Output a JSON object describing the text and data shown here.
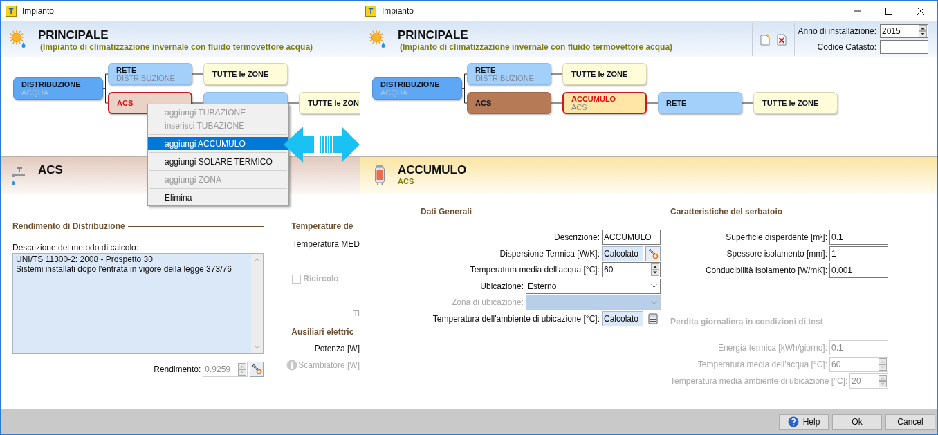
{
  "left_window": {
    "title": "Impianto",
    "icon_letter": "T",
    "header": {
      "title": "PRINCIPALE",
      "subtitle": "(Impianto di climatizzazione invernale con fluido termovettore acqua)"
    },
    "diagram": {
      "label": "DISTRIBUZIONE",
      "sublabel": "ACQUA",
      "kind": "distribuzione",
      "selected": false,
      "children": [
        {
          "label": "RETE",
          "sublabel": "DISTRIBUZIONE",
          "kind": "rete",
          "selected": false,
          "children": [
            {
              "label": "TUTTE le ZONE",
              "kind": "zone",
              "selected": false
            }
          ]
        },
        {
          "label": "ACS",
          "kind": "acs",
          "selected": true,
          "children": [
            {
              "kind": "rete",
              "selected": false,
              "children": [
                {
                  "label": "TUTTE le ZON",
                  "kind": "zone",
                  "selected": false
                }
              ]
            }
          ]
        }
      ]
    },
    "section": {
      "kind": "acs",
      "title": "ACS"
    },
    "distribution": {
      "heading": "Rendimento di Distribuzione",
      "description_label": "Descrizione del metodo di calcolo:",
      "description": "UNI/TS 11300-2: 2008 - Prospetto 30\nSistemi installati dopo l'entrata in vigore della legge 373/76",
      "efficiency_label": "Rendimento:",
      "efficiency_value": "0.9259",
      "efficiency_disabled": true
    },
    "side_items": [
      {
        "kind": "heading",
        "text": "Temperature de"
      },
      {
        "kind": "label",
        "text": "Temperatura MED",
        "disabled": false
      },
      {
        "kind": "checkbox",
        "text": "Ricircolo",
        "checked": false,
        "disabled": true
      },
      {
        "kind": "label",
        "text": "Ti",
        "disabled": true
      },
      {
        "kind": "heading",
        "text": "Ausiliari elettric"
      },
      {
        "kind": "label",
        "text": "Potenza [W]",
        "disabled": false
      },
      {
        "kind": "info",
        "text": "Scambiatore [W]",
        "disabled": true
      }
    ]
  },
  "context_menu": {
    "items": [
      {
        "label": "aggiungi TUBAZIONE",
        "disabled": true,
        "selected": false,
        "separator_before": false
      },
      {
        "label": "inserisci TUBAZIONE",
        "disabled": true,
        "selected": false,
        "separator_before": false
      },
      {
        "label": "aggiungi ACCUMULO",
        "disabled": false,
        "selected": true,
        "separator_before": true
      },
      {
        "label": "aggiungi SOLARE TERMICO",
        "disabled": false,
        "selected": false,
        "separator_before": true
      },
      {
        "label": "aggiungi ZONA",
        "disabled": true,
        "selected": false,
        "separator_before": true
      },
      {
        "label": "Elimina",
        "disabled": false,
        "selected": false,
        "separator_before": true
      }
    ]
  },
  "right_window": {
    "title": "Impianto",
    "icon_letter": "T",
    "header": {
      "title": "PRINCIPALE",
      "subtitle": "(Impianto di climatizzazione invernale con fluido termovettore acqua)",
      "year_label": "Anno di installazione:",
      "year": "2015",
      "cadastre_label": "Codice Catasto:"
    },
    "diagram": {
      "label": "DISTRIBUZIONE",
      "sublabel": "ACQUA",
      "kind": "distribuzione",
      "selected": false,
      "children": [
        {
          "label": "RETE",
          "sublabel": "DISTRIBUZIONE",
          "kind": "rete",
          "selected": false,
          "children": [
            {
              "label": "TUTTE le ZONE",
              "kind": "zone",
              "selected": false
            }
          ]
        },
        {
          "label": "ACS",
          "kind": "acs",
          "selected": false,
          "children": [
            {
              "label": "ACCUMULO",
              "sublabel": "ACS",
              "kind": "accumulo",
              "selected": true,
              "children": [
                {
                  "label": "RETE",
                  "kind": "rete",
                  "selected": false,
                  "children": [
                    {
                      "label": "TUTTE le ZONE",
                      "kind": "zone",
                      "selected": false
                    }
                  ]
                }
              ]
            }
          ]
        }
      ]
    },
    "section": {
      "kind": "accumulo",
      "title": "ACCUMULO",
      "subtitle": "ACS"
    },
    "general": {
      "heading": "Dati Generali",
      "disabled": false,
      "rows": [
        {
          "kind": "text",
          "label": "Descrizione:",
          "value": "ACCUMULO",
          "disabled": false
        },
        {
          "kind": "tool",
          "label": "Dispersione Termica [W/K]:",
          "value": "Calcolato",
          "disabled": false
        },
        {
          "kind": "spin",
          "label": "Temperatura media dell'acqua [°C]:",
          "value": "60",
          "disabled": false
        },
        {
          "kind": "select",
          "label": "Ubicazione:",
          "value": "Esterno",
          "disabled": false
        },
        {
          "kind": "select",
          "label": "Zona di ubicazione:",
          "disabled": true
        },
        {
          "kind": "calculator",
          "label": "Temperatura dell'ambiente di ubicazione [°C]:",
          "value": "Calcolato",
          "disabled": false
        }
      ]
    },
    "tank": {
      "heading": "Caratteristiche del serbatoio",
      "disabled": false,
      "rows": [
        {
          "kind": "text",
          "label": "Superficie disperdente [m²]:",
          "value": "0.1",
          "disabled": false
        },
        {
          "kind": "text",
          "label": "Spessore isolamento [mm]:",
          "value": "1",
          "disabled": false
        },
        {
          "kind": "text",
          "label": "Conducibilità isolamento [W/mK]:",
          "value": "0.001",
          "disabled": false
        }
      ]
    },
    "test_loss": {
      "heading": "Perdita giornaliera in condizioni di test",
      "disabled": true,
      "rows": [
        {
          "kind": "text",
          "label": "Energia termica [kWh/giorno]:",
          "value": "0.1",
          "disabled": true
        },
        {
          "kind": "spin",
          "label": "Temperatura media dell'acqua [°C]:",
          "value": "60",
          "disabled": true
        },
        {
          "kind": "spin",
          "label": "Temperatura media ambiente di ubicazione [°C]:",
          "value": "20",
          "disabled": true
        }
      ]
    },
    "buttons": [
      {
        "label": "Help",
        "kind": "help"
      },
      {
        "label": "Ok",
        "kind": "plain"
      },
      {
        "label": "Cancel",
        "kind": "plain"
      }
    ]
  }
}
